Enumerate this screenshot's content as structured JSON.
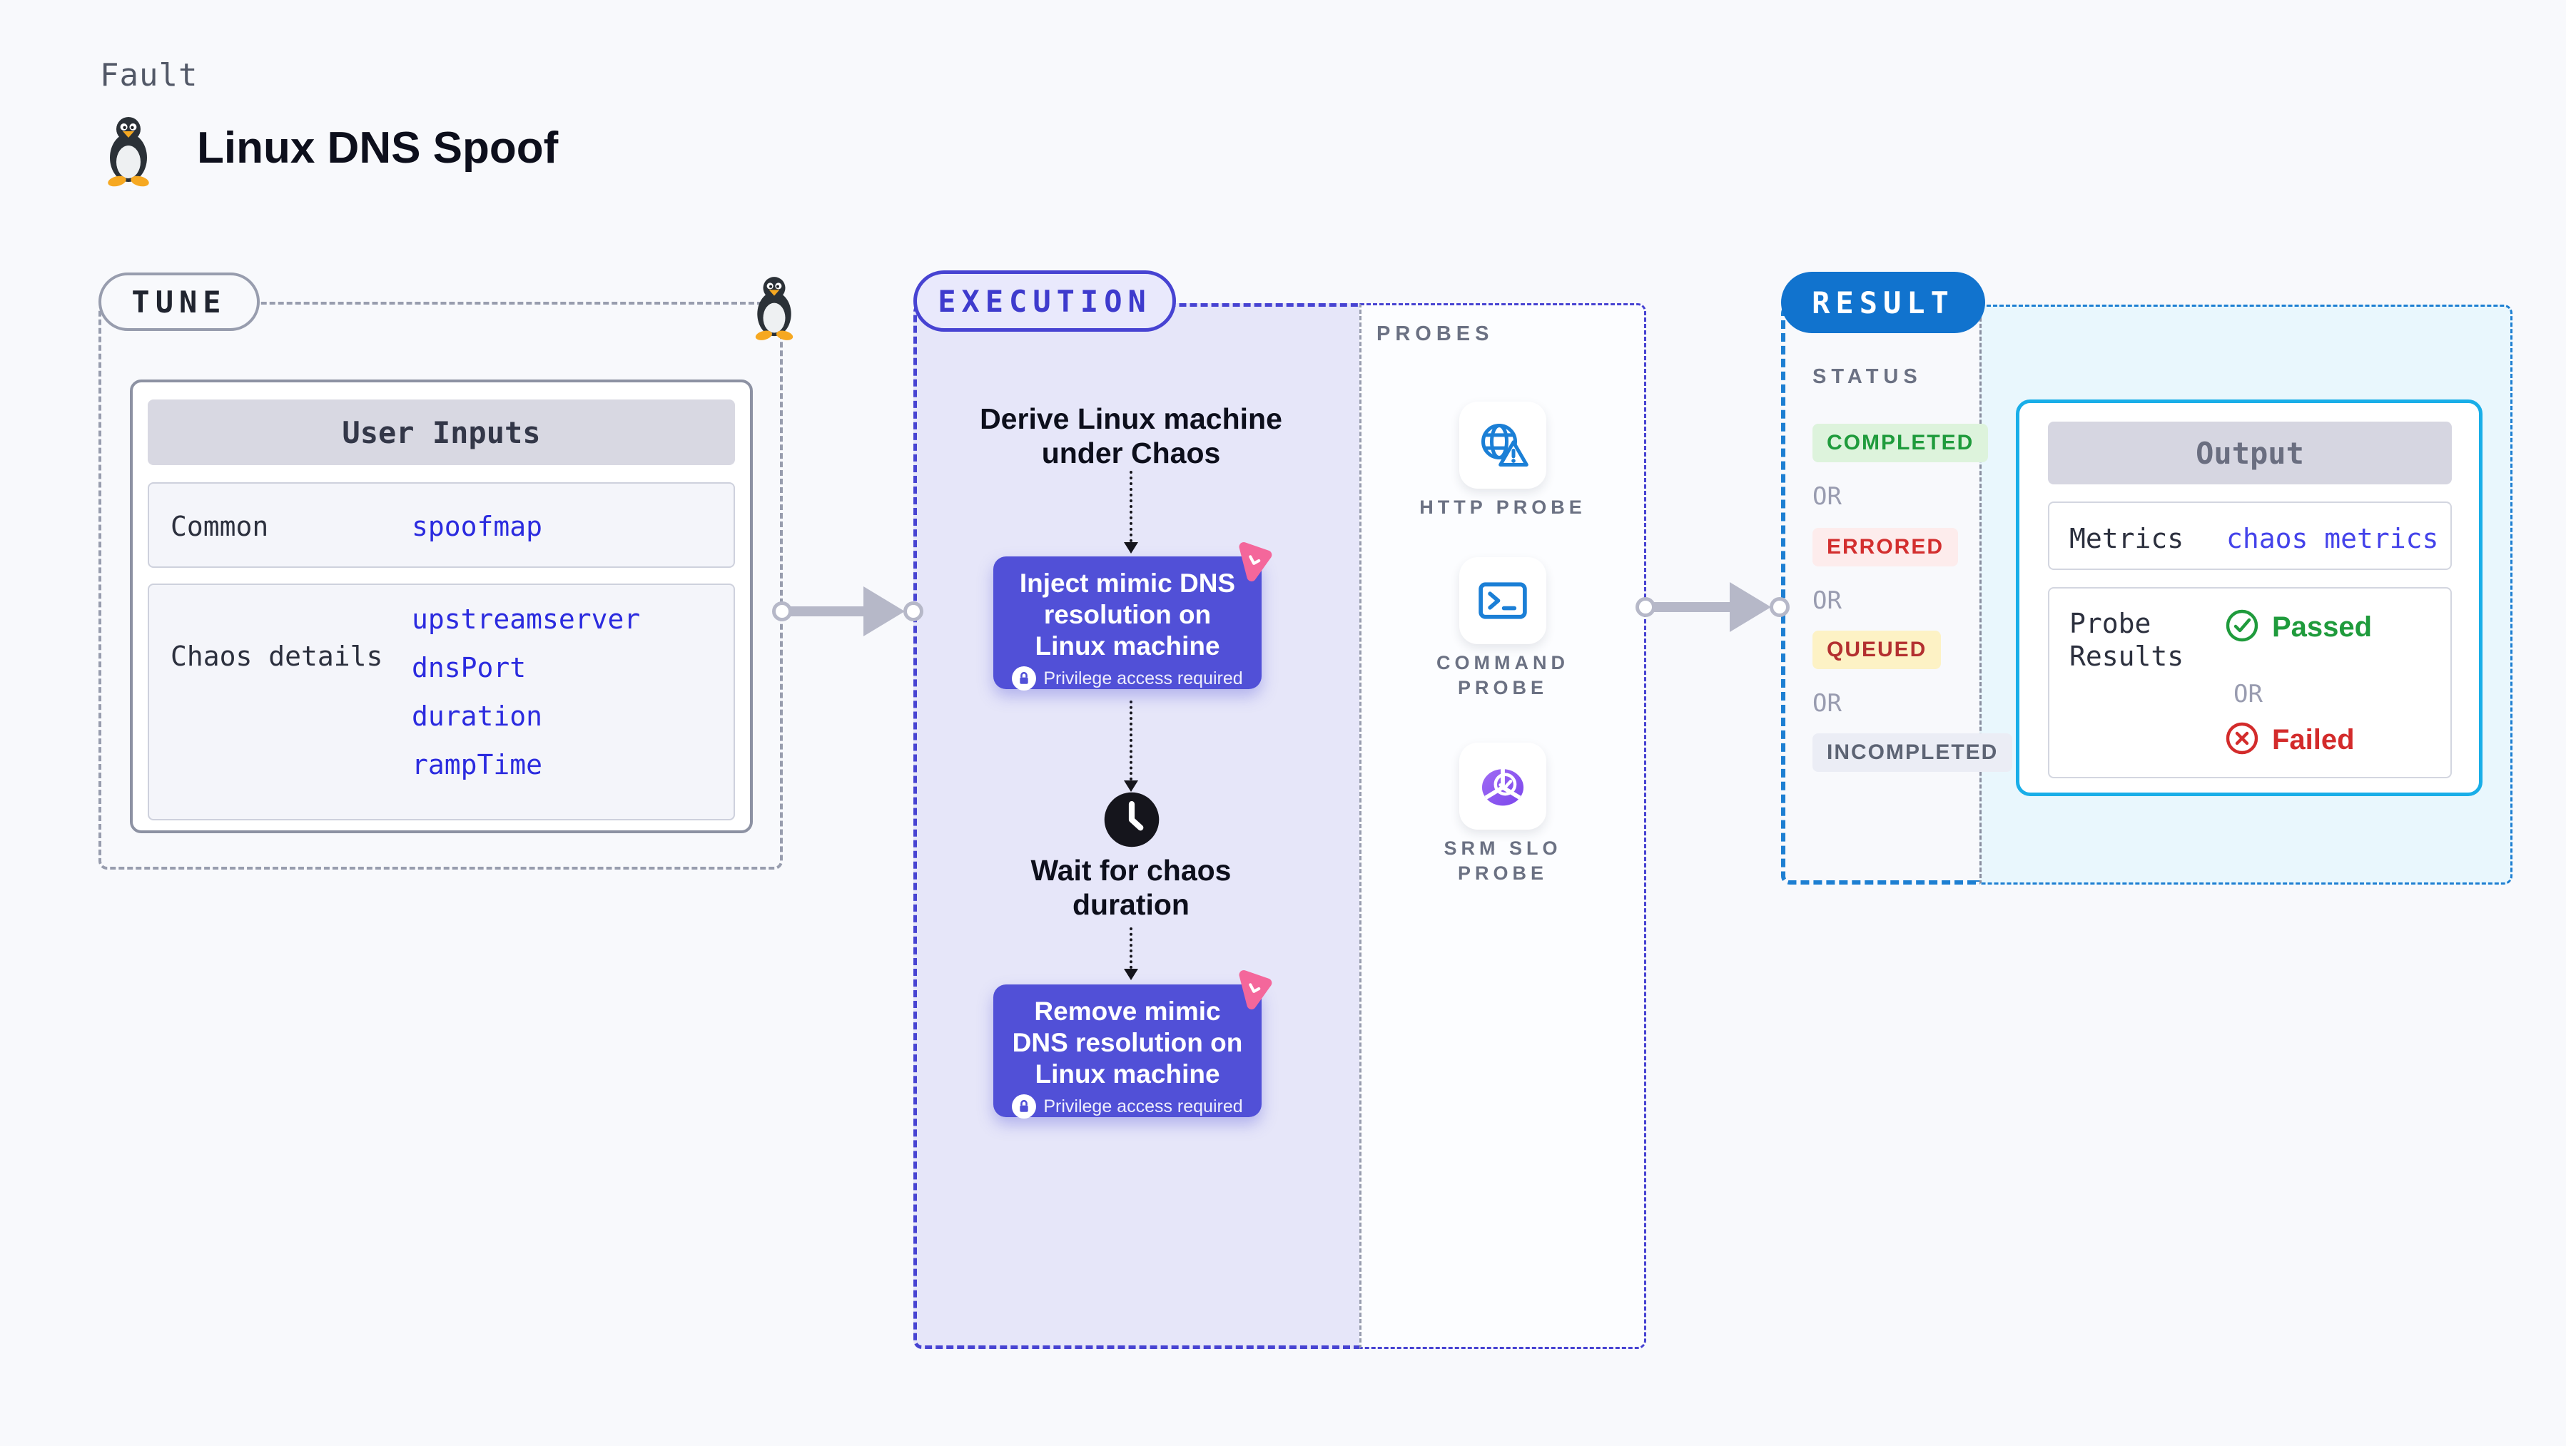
{
  "header": {
    "eyebrow": "Fault",
    "title": "Linux DNS Spoof"
  },
  "tune": {
    "badge": "TUNE",
    "user_inputs": {
      "header": "User Inputs",
      "rows": [
        {
          "label": "Common",
          "values": [
            "spoofmap"
          ]
        },
        {
          "label": "Chaos details",
          "values": [
            "upstreamserver",
            "dnsPort",
            "duration",
            "rampTime"
          ]
        }
      ]
    }
  },
  "execution": {
    "badge": "EXECUTION",
    "derive_label": "Derive Linux machine under Chaos",
    "inject_label": "Inject mimic DNS resolution on Linux machine",
    "privilege_label": "Privilege access required",
    "wait_label": "Wait for chaos duration",
    "remove_label": "Remove mimic DNS resolution on Linux machine"
  },
  "probes": {
    "label": "PROBES",
    "items": [
      {
        "label": "HTTP PROBE",
        "icon": "globe-warning-icon"
      },
      {
        "label": "COMMAND PROBE",
        "icon": "terminal-icon"
      },
      {
        "label": "SRM SLO PROBE",
        "icon": "slo-donut-icon"
      }
    ]
  },
  "result": {
    "badge": "RESULT",
    "status": {
      "label": "STATUS",
      "or_label": "OR",
      "states": [
        {
          "label": "COMPLETED",
          "text_color": "#1f9b3c",
          "bg": "#ddf3dc"
        },
        {
          "label": "ERRORED",
          "text_color": "#d32f2f",
          "bg": "#fdecec"
        },
        {
          "label": "QUEUED",
          "text_color": "#b33030",
          "bg": "#fdf2c5"
        },
        {
          "label": "INCOMPLETED",
          "text_color": "#5d6474",
          "bg": "#ebedf5"
        }
      ]
    },
    "output": {
      "header": "Output",
      "metrics_label": "Metrics",
      "metrics_value": "chaos metrics",
      "probe_results_label": "Probe Results",
      "passed_label": "Passed",
      "or_label": "OR",
      "failed_label": "Failed"
    }
  },
  "colors": {
    "background": "#f8f9fc",
    "indigo_dashed": "#4743d2",
    "gray_dashed": "#989dae",
    "blue_dashed": "#1d7fd2",
    "purple_node": "#5150d7",
    "result_badge_blue": "#1173ce",
    "output_border_cyan": "#19aee8",
    "litmus_pink": "#f4679b",
    "probe_icon_blue": "#1b7fd6",
    "value_indigo": "#2b2bdf",
    "passed_green": "#1f9b3c",
    "failed_red": "#d32b2b",
    "arrow_gray": "#b6b8c8"
  },
  "icons": {
    "penguin-icon": "tux penguin",
    "litmus-chaos-icon": "pink rounded triangle logo",
    "lock-icon": "padlock in white circle",
    "clock-icon": "black clock",
    "globe-warning-icon": "globe with warning triangle",
    "terminal-icon": "command prompt window",
    "slo-donut-icon": "purple segmented donut with check",
    "check-circle-icon": "green circled check",
    "x-circle-icon": "red circled x"
  }
}
